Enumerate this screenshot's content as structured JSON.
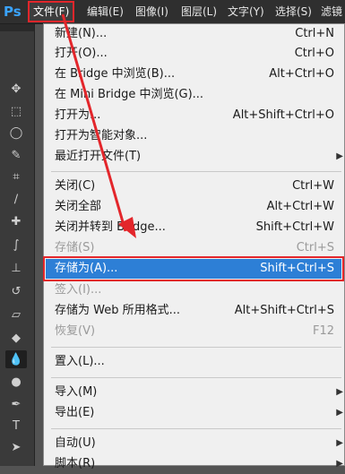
{
  "app": {
    "logo": "Ps"
  },
  "menubar": {
    "items": [
      {
        "label": "文件(F)"
      },
      {
        "label": "编辑(E)"
      },
      {
        "label": "图像(I)"
      },
      {
        "label": "图层(L)"
      },
      {
        "label": "文字(Y)"
      },
      {
        "label": "选择(S)"
      },
      {
        "label": "滤镜"
      }
    ]
  },
  "toolbox": {
    "tools": [
      {
        "icon": "move-icon"
      },
      {
        "icon": "marquee-icon"
      },
      {
        "icon": "lasso-icon"
      },
      {
        "icon": "quick-select-icon"
      },
      {
        "icon": "crop-icon"
      },
      {
        "icon": "eyedropper-icon"
      },
      {
        "icon": "healing-brush-icon"
      },
      {
        "icon": "brush-icon"
      },
      {
        "icon": "clone-stamp-icon"
      },
      {
        "icon": "history-brush-icon"
      },
      {
        "icon": "eraser-icon"
      },
      {
        "icon": "paint-bucket-icon"
      },
      {
        "icon": "blur-icon"
      },
      {
        "icon": "dodge-icon"
      },
      {
        "icon": "pen-icon"
      },
      {
        "icon": "type-icon"
      },
      {
        "icon": "path-select-icon"
      },
      {
        "icon": "shape-icon"
      }
    ]
  },
  "file_menu": {
    "items": [
      {
        "label": "新建(N)...",
        "shortcut": "Ctrl+N"
      },
      {
        "label": "打开(O)...",
        "shortcut": "Ctrl+O"
      },
      {
        "label": "在 Bridge 中浏览(B)...",
        "shortcut": "Alt+Ctrl+O"
      },
      {
        "label": "在 Mini Bridge 中浏览(G)...",
        "shortcut": ""
      },
      {
        "label": "打开为...",
        "shortcut": "Alt+Shift+Ctrl+O"
      },
      {
        "label": "打开为智能对象...",
        "shortcut": ""
      },
      {
        "label": "最近打开文件(T)",
        "shortcut": ""
      },
      {
        "label": "关闭(C)",
        "shortcut": "Ctrl+W"
      },
      {
        "label": "关闭全部",
        "shortcut": "Alt+Ctrl+W"
      },
      {
        "label": "关闭并转到 Bridge...",
        "shortcut": "Shift+Ctrl+W"
      },
      {
        "label": "存储(S)",
        "shortcut": "Ctrl+S"
      },
      {
        "label": "存储为(A)...",
        "shortcut": "Shift+Ctrl+S"
      },
      {
        "label": "签入(I)...",
        "shortcut": ""
      },
      {
        "label": "存储为 Web 所用格式...",
        "shortcut": "Alt+Shift+Ctrl+S"
      },
      {
        "label": "恢复(V)",
        "shortcut": "F12"
      },
      {
        "label": "置入(L)...",
        "shortcut": ""
      },
      {
        "label": "导入(M)",
        "shortcut": ""
      },
      {
        "label": "导出(E)",
        "shortcut": ""
      },
      {
        "label": "自动(U)",
        "shortcut": ""
      },
      {
        "label": "脚本(R)",
        "shortcut": ""
      }
    ],
    "submenu_arrow": "▶"
  },
  "colors": {
    "highlight": "#2d7fd6",
    "annotation": "#e3262b"
  }
}
